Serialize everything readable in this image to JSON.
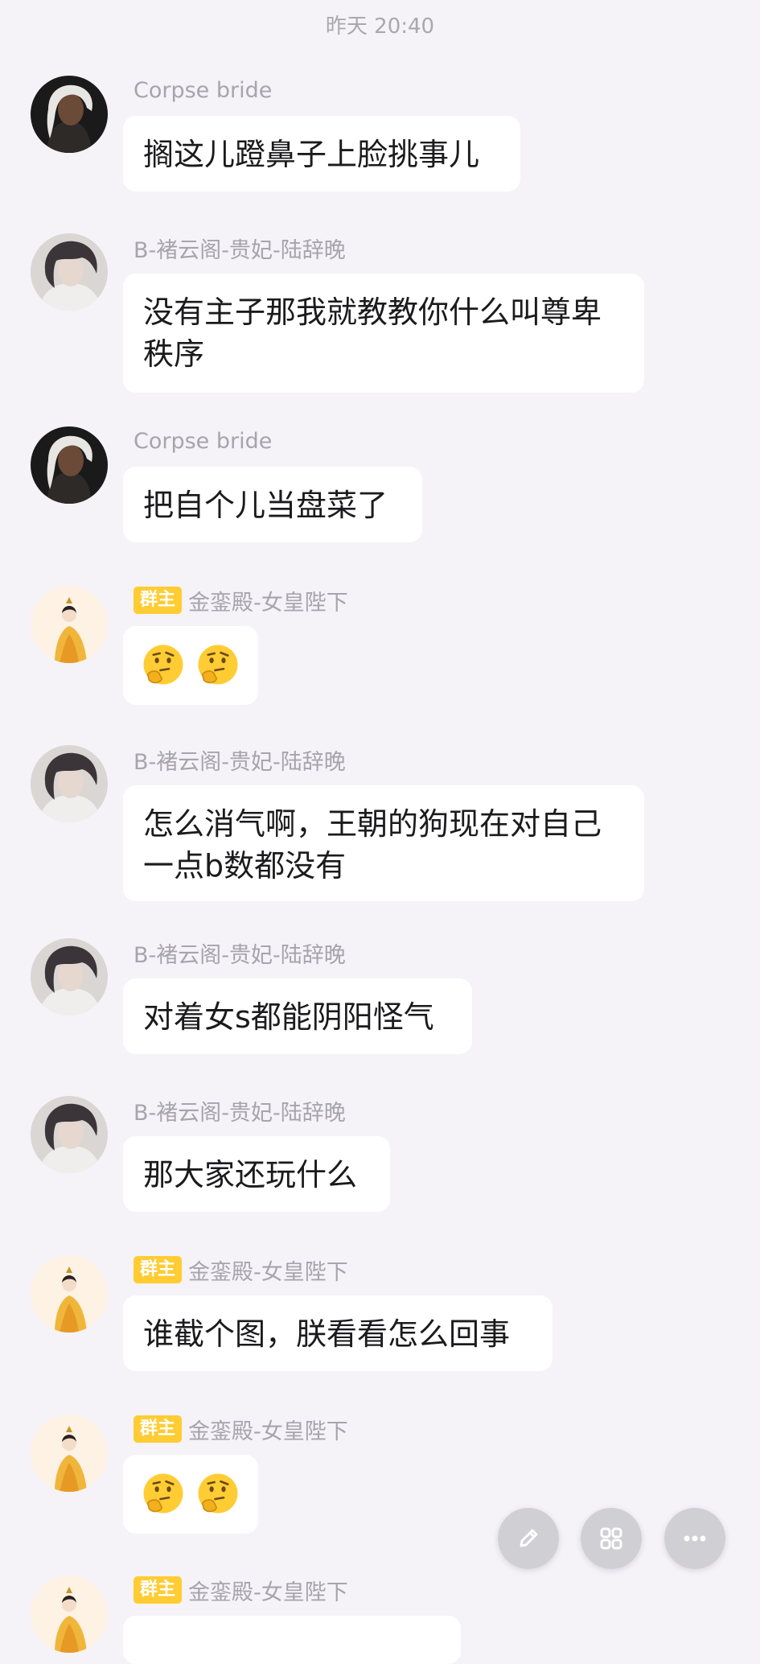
{
  "timestamp": "昨天 20:40",
  "messages": [
    {
      "sender": "Corpse bride",
      "role": "",
      "text": "搁这儿蹬鼻子上脸挑事儿",
      "avatar": "dark-haired-avatar-1"
    },
    {
      "sender": "B-褚云阁-贵妃-陆辞晚",
      "role": "",
      "text": "没有主子那我就教教你什么叫尊卑秩序",
      "avatar": "dark-haired-avatar-2"
    },
    {
      "sender": "Corpse bride",
      "role": "",
      "text": "把自个儿当盘菜了",
      "avatar": "dark-haired-avatar-1"
    },
    {
      "sender": "金銮殿-女皇陛下",
      "role": "群主",
      "text": "",
      "emoji": [
        "thinking-face-emoji",
        "thinking-face-emoji"
      ],
      "avatar": "empress-avatar"
    },
    {
      "sender": "B-褚云阁-贵妃-陆辞晚",
      "role": "",
      "text": "怎么消气啊，王朝的狗现在对自己一点b数都没有",
      "avatar": "dark-haired-avatar-2"
    },
    {
      "sender": "B-褚云阁-贵妃-陆辞晚",
      "role": "",
      "text": "对着女s都能阴阳怪气",
      "avatar": "dark-haired-avatar-2"
    },
    {
      "sender": "B-褚云阁-贵妃-陆辞晚",
      "role": "",
      "text": "那大家还玩什么",
      "avatar": "dark-haired-avatar-2"
    },
    {
      "sender": "金銮殿-女皇陛下",
      "role": "群主",
      "text": "谁截个图，朕看看怎么回事",
      "avatar": "empress-avatar"
    },
    {
      "sender": "金銮殿-女皇陛下",
      "role": "群主",
      "text": "",
      "emoji": [
        "thinking-face-emoji",
        "thinking-face-emoji"
      ],
      "avatar": "empress-avatar"
    },
    {
      "sender": "金銮殿-女皇陛下",
      "role": "群主",
      "text": "",
      "avatar": "empress-avatar"
    }
  ],
  "fabs": [
    {
      "name": "edit",
      "icon": "pencil-icon"
    },
    {
      "name": "apps",
      "icon": "grid-icon"
    },
    {
      "name": "more",
      "icon": "more-icon"
    }
  ],
  "colors": {
    "background": "#f5f3f8",
    "bubble": "#ffffff",
    "badge": "#ffcc33",
    "meta": "#a5a5ab",
    "fab_icon": "#ffffff",
    "fab_bg": "#c9c9ce"
  }
}
